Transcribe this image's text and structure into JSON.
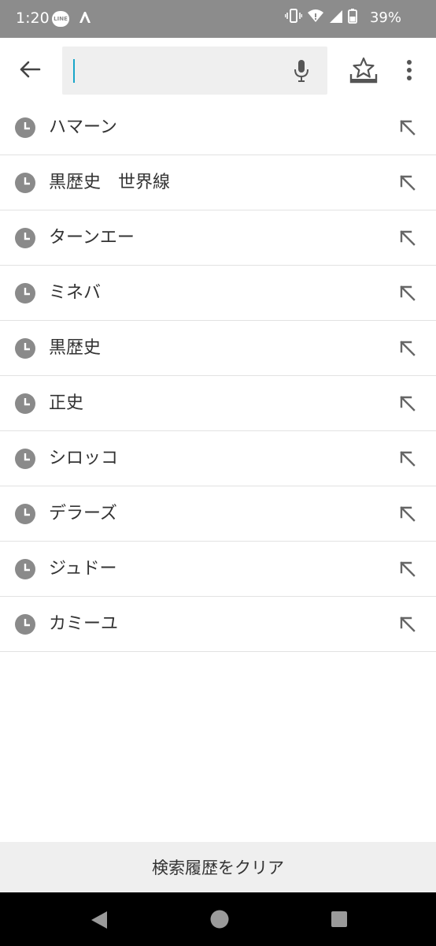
{
  "status_bar": {
    "time": "1:20",
    "line_badge": "LINE",
    "battery_percent": "39%",
    "icons": [
      "line-icon",
      "app-icon",
      "vibrate-icon",
      "wifi-icon",
      "signal-icon",
      "battery-icon"
    ]
  },
  "toolbar": {
    "search_value": "",
    "icons": [
      "back-arrow-icon",
      "mic-icon",
      "bookmark-star-icon",
      "more-vert-icon"
    ]
  },
  "history": {
    "items": [
      {
        "label": "ハマーン"
      },
      {
        "label": "黒歴史　世界線"
      },
      {
        "label": "ターンエー"
      },
      {
        "label": "ミネバ"
      },
      {
        "label": "黒歴史"
      },
      {
        "label": "正史"
      },
      {
        "label": "シロッコ"
      },
      {
        "label": "デラーズ"
      },
      {
        "label": "ジュドー"
      },
      {
        "label": "カミーユ"
      }
    ],
    "item_icon": "clock-icon",
    "action_icon": "arrow-up-left-icon"
  },
  "clear_history_label": "検索履歴をクリア",
  "colors": {
    "status_bar": "#8c8c8c",
    "caret": "#19a6c9",
    "icon_gray": "#8a8a8a",
    "search_bg": "#efefef",
    "nav_bar": "#000000"
  }
}
